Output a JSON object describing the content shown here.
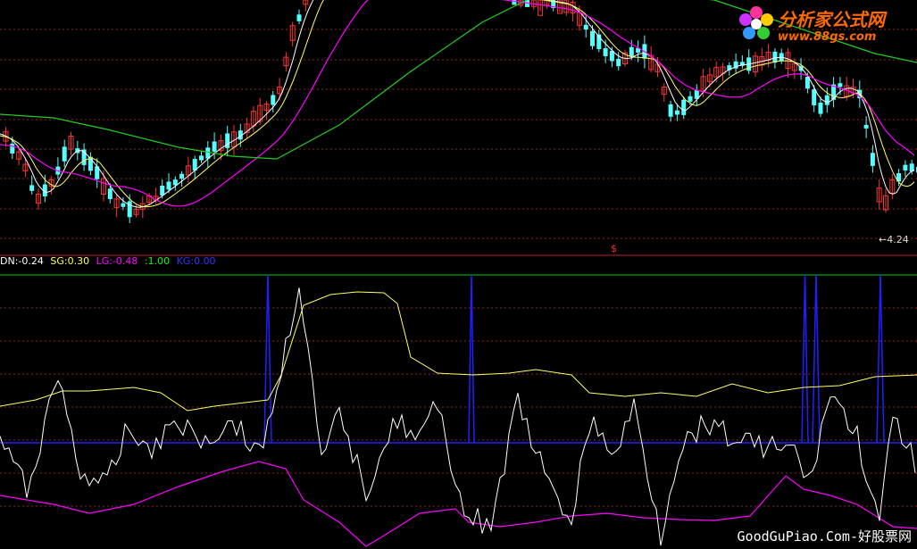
{
  "chart_data": [
    {
      "type": "candlestick",
      "panel": "price",
      "series": [
        {
          "name": "",
          "color": "#ffffff"
        },
        {
          "name": "",
          "color": "#ffff66"
        },
        {
          "name": "",
          "color": "#ff00ff"
        },
        {
          "name": "",
          "color": "#00cc00"
        }
      ],
      "annotations": {
        "low_marker": "4.24",
        "event_marker": "$"
      }
    },
    {
      "type": "line",
      "panel": "indicator",
      "legend": [
        {
          "label": "DN:-0.24",
          "color": "#ffffff"
        },
        {
          "label": "SG:0.30",
          "color": "#ffff66"
        },
        {
          "label": "LG:-0.48",
          "color": "#ff00ff"
        },
        {
          "label": ":1.00",
          "color": "#00ff00"
        },
        {
          "label": "KG:0.00",
          "color": "#3333ff"
        }
      ]
    }
  ],
  "branding": {
    "logo_cn": "分析家公式网",
    "logo_url": "www.88gs.com",
    "footer": "GoodGuPiao.Com-好股票网"
  },
  "colors": {
    "background": "#000000",
    "up_candle": "#ff3232",
    "down_candle": "#54ffff",
    "grid": "#8b2a1a",
    "divider": "#b22222",
    "kg_line": "#2020ff"
  }
}
